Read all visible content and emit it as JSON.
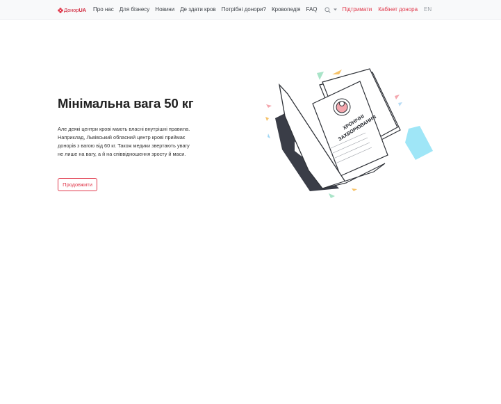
{
  "header": {
    "logo_text": "Донор",
    "logo_suffix": "UA",
    "nav": [
      "Про нас",
      "Для бізнесу",
      "Новини",
      "Де здати кров",
      "Потрібні донори?",
      "Кровопедія",
      "FAQ"
    ],
    "support_label": "Підтримати",
    "cabinet_label": "Кабінет донора",
    "language": "EN"
  },
  "content": {
    "title": "Мінімальна вага 50 кг",
    "text": "Але деякі центри крові мають власні внутрішні правила. Наприклад, Львівський обласний центр крові приймає донорів з вагою від 60 кг. Також медики звертають увагу не лише на вагу, а й на співвідношення зросту й маси.",
    "button_label": "Продовжити"
  },
  "illustration": {
    "document_label_line1": "ХРОНІЧНІ",
    "document_label_line2": "ЗАХВОРЮВАННЯ"
  },
  "colors": {
    "accent": "#e03649",
    "navbar_bg": "#f8f9fa",
    "folder_dark": "#3a3d47",
    "illustration_cyan": "#9fe6f7"
  },
  "icons": [
    "logo-mark-icon",
    "search-icon",
    "chevron-down-icon"
  ]
}
